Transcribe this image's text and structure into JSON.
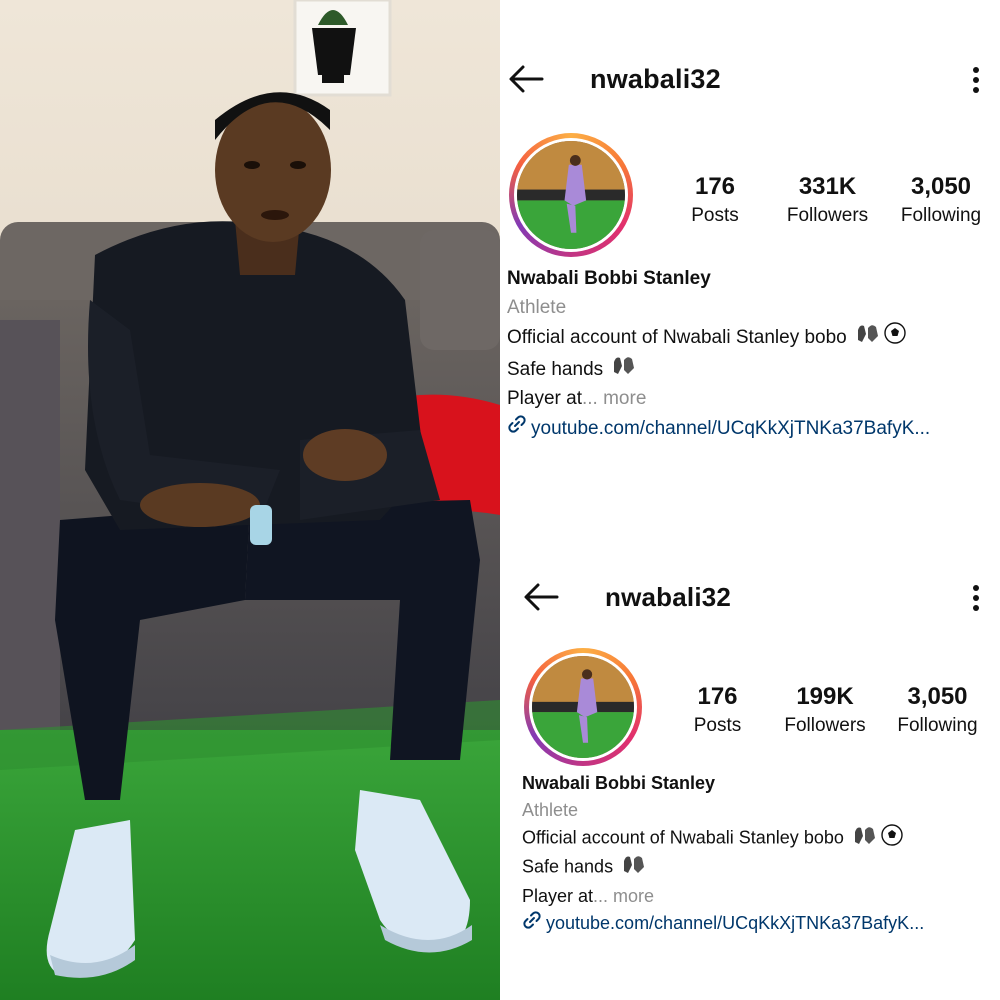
{
  "profiles": [
    {
      "username": "nwabali32",
      "stats": [
        {
          "value": "176",
          "label": "Posts"
        },
        {
          "value": "331K",
          "label": "Followers"
        },
        {
          "value": "3,050",
          "label": "Following"
        }
      ],
      "display_name": "Nwabali Bobbi Stanley",
      "category": "Athlete",
      "bio_line1": "Official account of Nwabali Stanley bobo",
      "bio_line2": "Safe hands",
      "bio_line3": "Player at",
      "more_label": "... more",
      "link": "youtube.com/channel/UCqKkXjTNKa37BafyK..."
    },
    {
      "username": "nwabali32",
      "stats": [
        {
          "value": "176",
          "label": "Posts"
        },
        {
          "value": "199K",
          "label": "Followers"
        },
        {
          "value": "3,050",
          "label": "Following"
        }
      ],
      "display_name": "Nwabali Bobbi Stanley",
      "category": "Athlete",
      "bio_line1": "Official account of Nwabali Stanley bobo",
      "bio_line2": "Safe hands",
      "bio_line3": "Player at",
      "more_label": "... more",
      "link": "youtube.com/channel/UCqKkXjTNKa37BafyK..."
    }
  ],
  "icons": {
    "back": "back-arrow-icon",
    "menu": "more-options-icon",
    "link": "link-icon",
    "gloves": "goalkeeper-gloves-emoji",
    "ball": "soccer-ball-emoji"
  },
  "colors": {
    "link": "#00376b",
    "secondary_text": "#8e8e8e",
    "story_ring": [
      "#fcaf45",
      "#e1306c",
      "#833ab4"
    ]
  }
}
